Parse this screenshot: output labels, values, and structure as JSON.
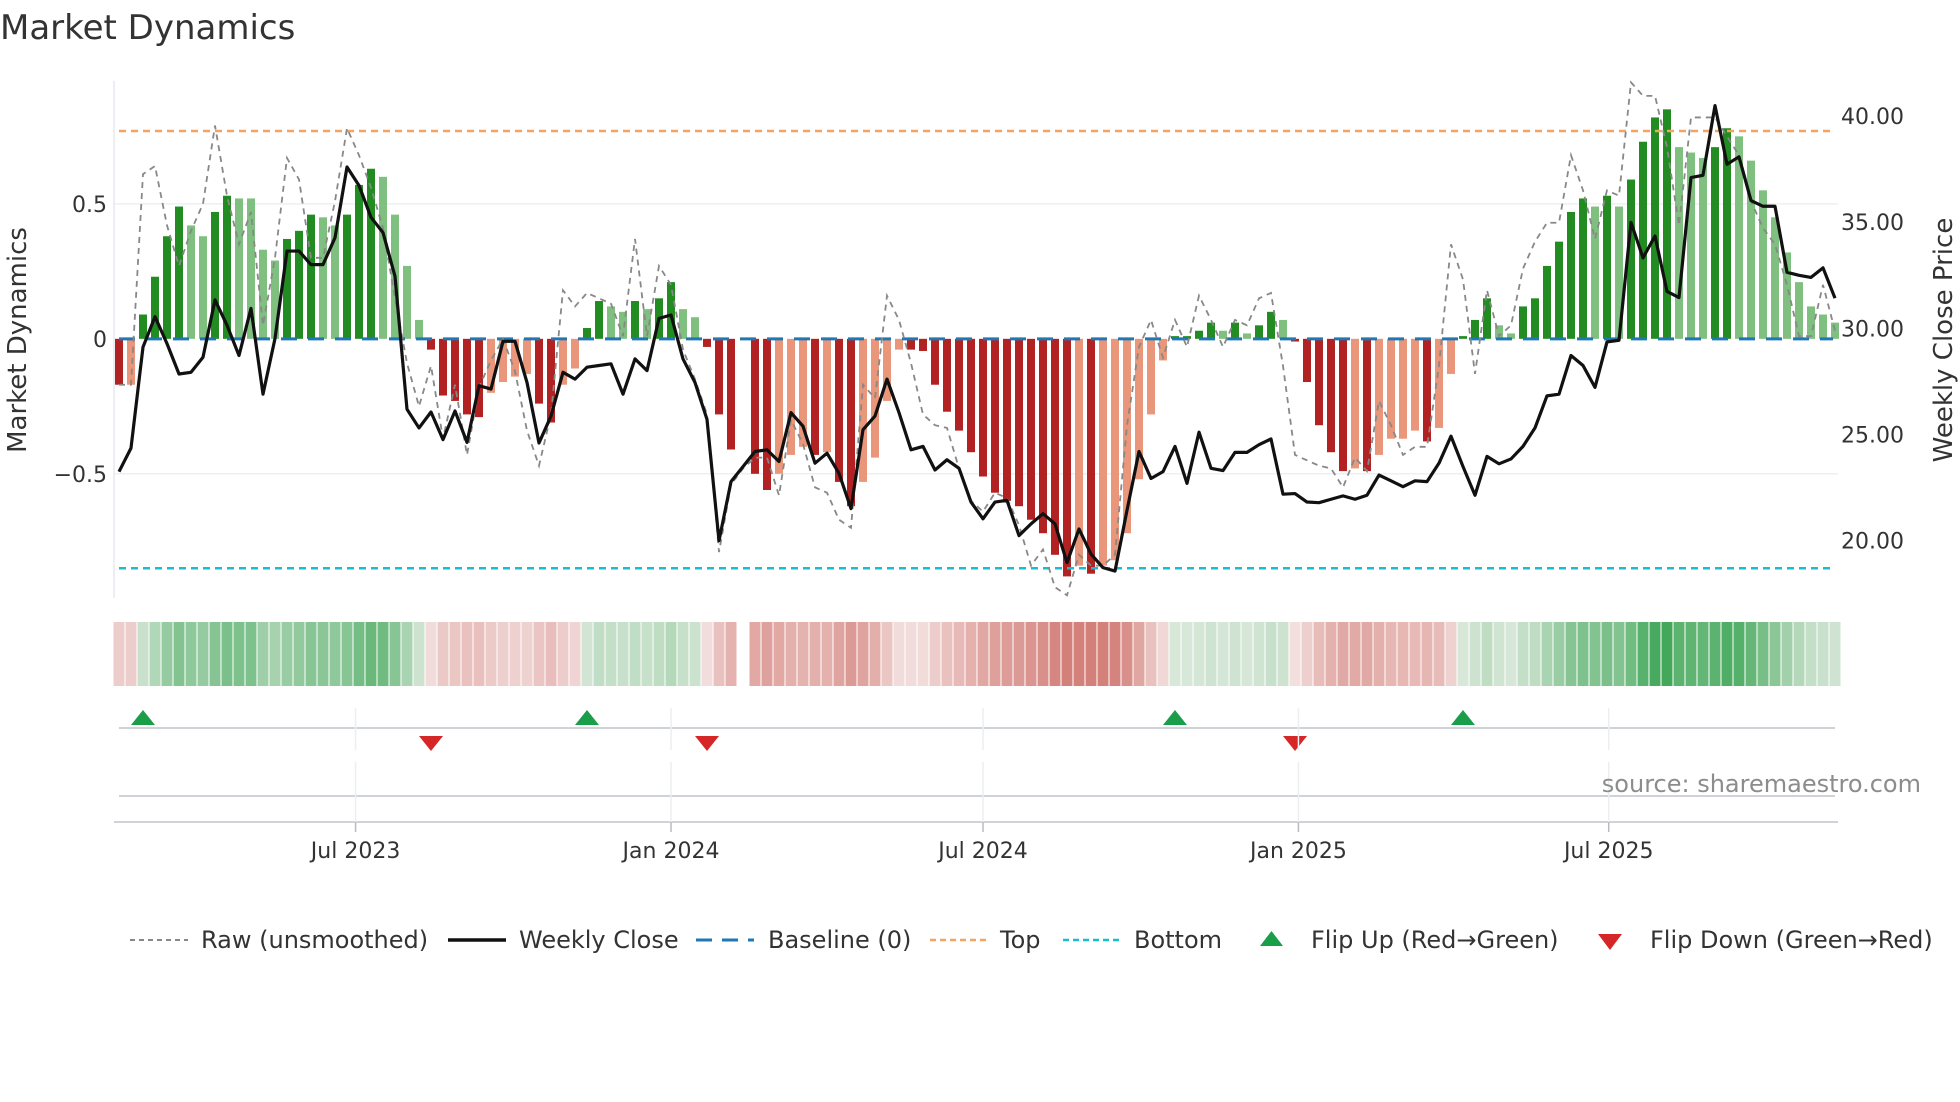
{
  "chart_data": {
    "type": "bar",
    "title": "Market Dynamics",
    "ylabel": "Market Dynamics",
    "ylabel_right": "Weekly Close Price",
    "ylim": [
      -0.96,
      0.955
    ],
    "ylim_right": [
      17.3,
      41.65
    ],
    "left_ticks": [
      {
        "v": 0.5,
        "label": "0.5"
      },
      {
        "v": 0,
        "label": "0"
      },
      {
        "v": -0.5,
        "label": "−0.5"
      }
    ],
    "right_ticks": [
      {
        "v": 40,
        "label": "40.00"
      },
      {
        "v": 35,
        "label": "35.00"
      },
      {
        "v": 30,
        "label": "30.00"
      },
      {
        "v": 25,
        "label": "25.00"
      },
      {
        "v": 20,
        "label": "20.00"
      }
    ],
    "x_start": "2023-02-13",
    "x_step_days": 7,
    "x_ticks": [
      {
        "date": "2023-07-01",
        "label": "Jul 2023"
      },
      {
        "date": "2024-01-01",
        "label": "Jan 2024"
      },
      {
        "date": "2024-07-01",
        "label": "Jul 2024"
      },
      {
        "date": "2025-01-01",
        "label": "Jan 2025"
      },
      {
        "date": "2025-07-01",
        "label": "Jul 2025"
      }
    ],
    "top_level": 0.77,
    "bottom_level": -0.85,
    "baseline": 0,
    "colors": {
      "green_dark": "#228b22",
      "green_light": "#7fbf7f",
      "red_dark": "#b22222",
      "red_light": "#e9967a",
      "close": "#111111",
      "raw": "#888888",
      "baseline": "#1f77b4",
      "top": "#f4a460",
      "bottom": "#17becf",
      "flip_up": "#1a9e4a",
      "flip_down": "#d62728",
      "heat_green": "#43a85a",
      "heat_red": "#d4807a"
    },
    "dynamics": [
      -0.17,
      -0.17,
      0.09,
      0.23,
      0.38,
      0.49,
      0.42,
      0.38,
      0.47,
      0.53,
      0.52,
      0.52,
      0.33,
      0.29,
      0.37,
      0.4,
      0.46,
      0.45,
      0.42,
      0.46,
      0.57,
      0.63,
      0.6,
      0.46,
      0.27,
      0.07,
      -0.04,
      -0.21,
      -0.23,
      -0.28,
      -0.29,
      -0.2,
      -0.16,
      -0.14,
      -0.13,
      -0.24,
      -0.31,
      -0.17,
      -0.11,
      0.04,
      0.14,
      0.12,
      0.1,
      0.14,
      0.11,
      0.15,
      0.21,
      0.11,
      0.08,
      -0.03,
      -0.28,
      -0.41,
      null,
      -0.5,
      -0.56,
      -0.5,
      -0.43,
      -0.4,
      -0.43,
      -0.42,
      -0.53,
      -0.62,
      -0.53,
      -0.44,
      -0.23,
      -0.04,
      -0.04,
      -0.045,
      -0.17,
      -0.27,
      -0.34,
      -0.42,
      -0.51,
      -0.57,
      -0.6,
      -0.62,
      -0.67,
      -0.72,
      -0.8,
      -0.88,
      -0.84,
      -0.87,
      -0.84,
      -0.82,
      -0.72,
      -0.52,
      -0.28,
      -0.08,
      0.01,
      0.01,
      0.03,
      0.06,
      0.03,
      0.06,
      0.02,
      0.05,
      0.1,
      0.07,
      -0.01,
      -0.16,
      -0.32,
      -0.42,
      -0.49,
      -0.48,
      -0.49,
      -0.43,
      -0.37,
      -0.37,
      -0.34,
      -0.38,
      -0.33,
      -0.13,
      0.01,
      0.07,
      0.15,
      0.05,
      0.02,
      0.12,
      0.15,
      0.27,
      0.36,
      0.47,
      0.52,
      0.49,
      0.53,
      0.49,
      0.59,
      0.73,
      0.82,
      0.85,
      0.71,
      0.69,
      0.67,
      0.71,
      0.78,
      0.75,
      0.66,
      0.55,
      0.45,
      0.32,
      0.21,
      0.12,
      0.09,
      0.06
    ],
    "strengthening": [
      1,
      0,
      1,
      1,
      1,
      1,
      0,
      0,
      1,
      1,
      0,
      0,
      0,
      0,
      1,
      1,
      1,
      0,
      0,
      1,
      1,
      1,
      0,
      0,
      0,
      0,
      1,
      1,
      1,
      1,
      1,
      0,
      0,
      0,
      0,
      1,
      1,
      0,
      0,
      1,
      1,
      0,
      0,
      1,
      0,
      1,
      1,
      0,
      0,
      1,
      1,
      1,
      1,
      1,
      1,
      0,
      0,
      0,
      1,
      0,
      1,
      1,
      0,
      0,
      0,
      0,
      1,
      1,
      1,
      1,
      1,
      1,
      1,
      1,
      1,
      1,
      1,
      1,
      1,
      1,
      0,
      1,
      0,
      0,
      0,
      0,
      0,
      0,
      1,
      1,
      1,
      1,
      0,
      1,
      0,
      1,
      1,
      0,
      1,
      1,
      1,
      1,
      1,
      0,
      1,
      0,
      0,
      0,
      0,
      1,
      0,
      0,
      1,
      1,
      1,
      0,
      0,
      1,
      1,
      1,
      1,
      1,
      1,
      0,
      1,
      0,
      1,
      1,
      1,
      1,
      0,
      0,
      0,
      1,
      1,
      0,
      0,
      0,
      0,
      0,
      0,
      0,
      0,
      0
    ],
    "weekly_close": [
      23.25,
      24.36,
      29.12,
      30.55,
      29.28,
      27.85,
      27.93,
      28.64,
      31.34,
      30.15,
      28.72,
      30.94,
      26.9,
      29.52,
      33.64,
      33.64,
      33.0,
      33.0,
      34.27,
      37.6,
      36.73,
      35.23,
      34.51,
      32.45,
      26.19,
      25.31,
      26.06,
      24.76,
      26.11,
      24.63,
      27.3,
      27.14,
      29.39,
      29.39,
      27.45,
      24.6,
      25.87,
      27.93,
      27.61,
      28.17,
      28.25,
      28.33,
      26.9,
      28.56,
      28.01,
      30.47,
      30.63,
      28.56,
      27.45,
      25.71,
      20.0,
      22.78,
      23.49,
      24.2,
      24.28,
      23.73,
      26.03,
      25.39,
      23.65,
      24.12,
      23.17,
      21.51,
      25.23,
      25.87,
      27.61,
      26.03,
      24.28,
      24.44,
      23.33,
      23.81,
      23.41,
      21.82,
      21.03,
      21.82,
      21.9,
      20.24,
      20.79,
      21.27,
      20.79,
      18.97,
      20.55,
      19.37,
      18.73,
      18.57,
      21.43,
      24.2,
      22.93,
      23.25,
      24.44,
      22.7,
      25.11,
      23.41,
      23.3,
      24.16,
      24.16,
      24.52,
      24.79,
      22.19,
      22.22,
      21.82,
      21.79,
      21.95,
      22.11,
      21.95,
      22.14,
      23.09,
      22.82,
      22.54,
      22.82,
      22.78,
      23.65,
      24.92,
      23.49,
      22.14,
      23.97,
      23.62,
      23.85,
      24.44,
      25.31,
      26.82,
      26.9,
      28.72,
      28.25,
      27.22,
      29.36,
      29.44,
      34.99,
      33.32,
      34.35,
      31.74,
      31.45,
      37.1,
      37.21,
      40.49,
      37.73,
      38.08,
      36.02,
      35.75,
      35.75,
      32.64,
      32.5,
      32.4,
      32.85,
      31.42
    ],
    "raw": [
      -0.17,
      -0.17,
      0.61,
      0.64,
      0.42,
      0.27,
      0.4,
      0.5,
      0.79,
      0.53,
      0.35,
      0.47,
      0.05,
      0.3,
      0.67,
      0.59,
      0.3,
      0.3,
      0.51,
      0.78,
      0.68,
      0.56,
      0.41,
      0.15,
      -0.09,
      -0.25,
      -0.1,
      -0.37,
      -0.17,
      -0.43,
      -0.18,
      -0.08,
      0.0,
      -0.12,
      -0.34,
      -0.47,
      -0.28,
      0.18,
      0.12,
      0.17,
      0.15,
      0.13,
      0.01,
      0.37,
      0.01,
      0.27,
      0.2,
      -0.04,
      -0.15,
      -0.28,
      -0.79,
      -0.54,
      -0.48,
      -0.44,
      -0.44,
      -0.58,
      -0.3,
      -0.39,
      -0.55,
      -0.57,
      -0.67,
      -0.7,
      -0.17,
      -0.22,
      0.16,
      0.07,
      -0.09,
      -0.28,
      -0.32,
      -0.33,
      -0.48,
      -0.6,
      -0.64,
      -0.57,
      -0.59,
      -0.69,
      -0.84,
      -0.78,
      -0.92,
      -0.95,
      -0.8,
      -0.84,
      -0.84,
      -0.8,
      -0.32,
      -0.03,
      0.07,
      -0.07,
      0.07,
      -0.03,
      0.16,
      0.07,
      -0.03,
      0.07,
      0.05,
      0.15,
      0.17,
      -0.1,
      -0.43,
      -0.45,
      -0.47,
      -0.48,
      -0.55,
      -0.44,
      -0.49,
      -0.23,
      -0.32,
      -0.43,
      -0.4,
      -0.4,
      -0.1,
      0.35,
      0.22,
      -0.13,
      0.18,
      0.01,
      0.05,
      0.26,
      0.36,
      0.43,
      0.43,
      0.68,
      0.55,
      0.37,
      0.55,
      0.53,
      0.95,
      0.9,
      0.9,
      0.71,
      0.42,
      0.82,
      0.82,
      0.82,
      0.75,
      0.68,
      0.51,
      0.41,
      0.35,
      0.2,
      0.01,
      0.01,
      0.2,
      0.03
    ],
    "flip_up_index": [
      2,
      39,
      88,
      112
    ],
    "flip_down_index": [
      26,
      49,
      98
    ],
    "legend": {
      "raw": "Raw (unsmoothed)",
      "close": "Weekly Close",
      "baseline": "Baseline (0)",
      "top": "Top",
      "bottom": "Bottom",
      "flip_up": "Flip Up (Red→Green)",
      "flip_down": "Flip Down (Green→Red)"
    },
    "source": "source: sharemaestro.com"
  }
}
